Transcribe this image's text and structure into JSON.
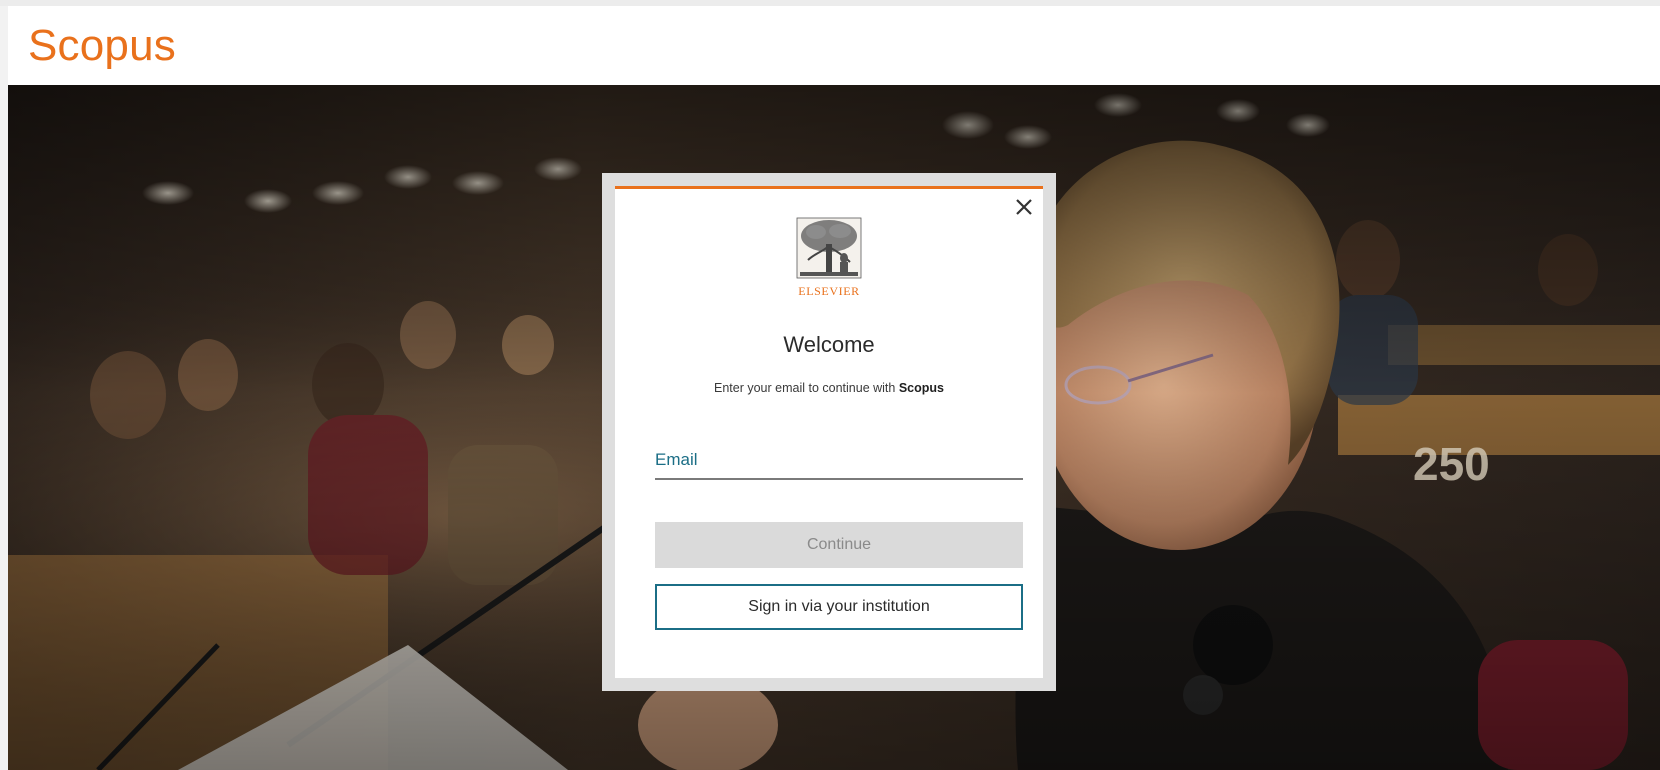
{
  "header": {
    "brand": "Scopus"
  },
  "modal": {
    "logo_text": "ELSEVIER",
    "title": "Welcome",
    "subtitle_prefix": "Enter your email to continue with ",
    "subtitle_brand": "Scopus",
    "email_placeholder": "Email",
    "email_value": "",
    "continue_label": "Continue",
    "institution_label": "Sign in via your institution",
    "close_icon": "close-icon",
    "tree_icon": "elsevier-tree-icon"
  },
  "theme": {
    "brand_color": "#e9711c",
    "link_color": "#1b6e86",
    "disabled_bg": "#dadada",
    "disabled_text": "#8a8a8a"
  }
}
